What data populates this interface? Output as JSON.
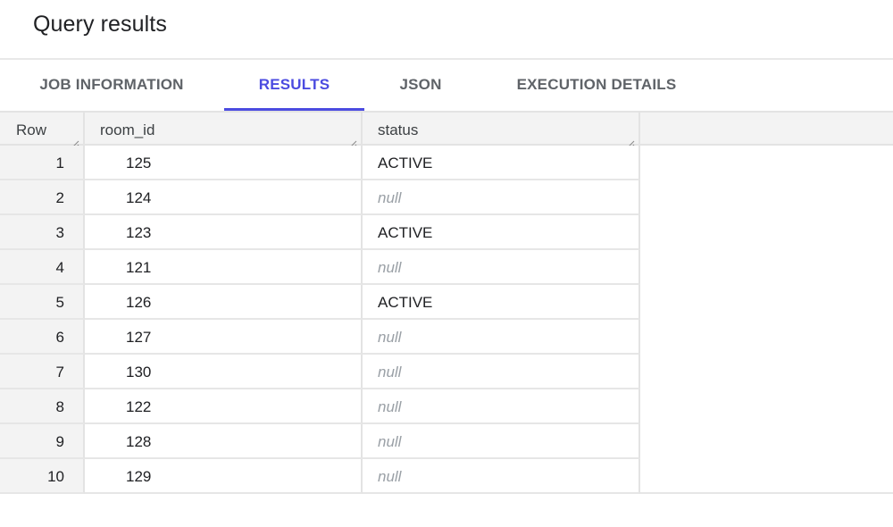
{
  "header": {
    "title": "Query results"
  },
  "tabs": [
    {
      "label": "JOB INFORMATION",
      "active": false
    },
    {
      "label": "RESULTS",
      "active": true
    },
    {
      "label": "JSON",
      "active": false
    },
    {
      "label": "EXECUTION DETAILS",
      "active": false
    }
  ],
  "colors": {
    "accent": "#4b4be0",
    "tab_inactive": "#5f6368",
    "null_text": "#9aa0a6",
    "header_bg": "#f3f3f3"
  },
  "table": {
    "columns": [
      "Row",
      "room_id",
      "status"
    ],
    "rows": [
      {
        "row": "1",
        "room_id": "125",
        "status": "ACTIVE"
      },
      {
        "row": "2",
        "room_id": "124",
        "status": "null"
      },
      {
        "row": "3",
        "room_id": "123",
        "status": "ACTIVE"
      },
      {
        "row": "4",
        "room_id": "121",
        "status": "null"
      },
      {
        "row": "5",
        "room_id": "126",
        "status": "ACTIVE"
      },
      {
        "row": "6",
        "room_id": "127",
        "status": "null"
      },
      {
        "row": "7",
        "room_id": "130",
        "status": "null"
      },
      {
        "row": "8",
        "room_id": "122",
        "status": "null"
      },
      {
        "row": "9",
        "room_id": "128",
        "status": "null"
      },
      {
        "row": "10",
        "room_id": "129",
        "status": "null"
      }
    ]
  }
}
